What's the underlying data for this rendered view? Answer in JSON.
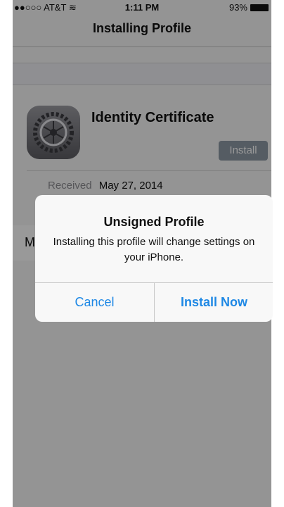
{
  "status_bar": {
    "carrier": "●●○○○ AT&T",
    "time": "1:11 PM",
    "battery": "93%"
  },
  "nav": {
    "title": "Installing Profile"
  },
  "profile": {
    "name": "Identity Certificate",
    "install_button": "Install",
    "received_label": "Received",
    "received_value": "May 27, 2014",
    "more_row_letter": "M",
    "more_row_chevron": "›"
  },
  "alert": {
    "title": "Unsigned Profile",
    "message": "Installing this profile will change settings on your iPhone.",
    "cancel": "Cancel",
    "confirm": "Install Now"
  },
  "icons": {
    "wifi": "wifi-icon",
    "battery": "battery-icon",
    "app_icon": "settings-gear-icon"
  },
  "colors": {
    "accent_blue": "#1e88e5",
    "install_button": "#8e9aa6"
  }
}
